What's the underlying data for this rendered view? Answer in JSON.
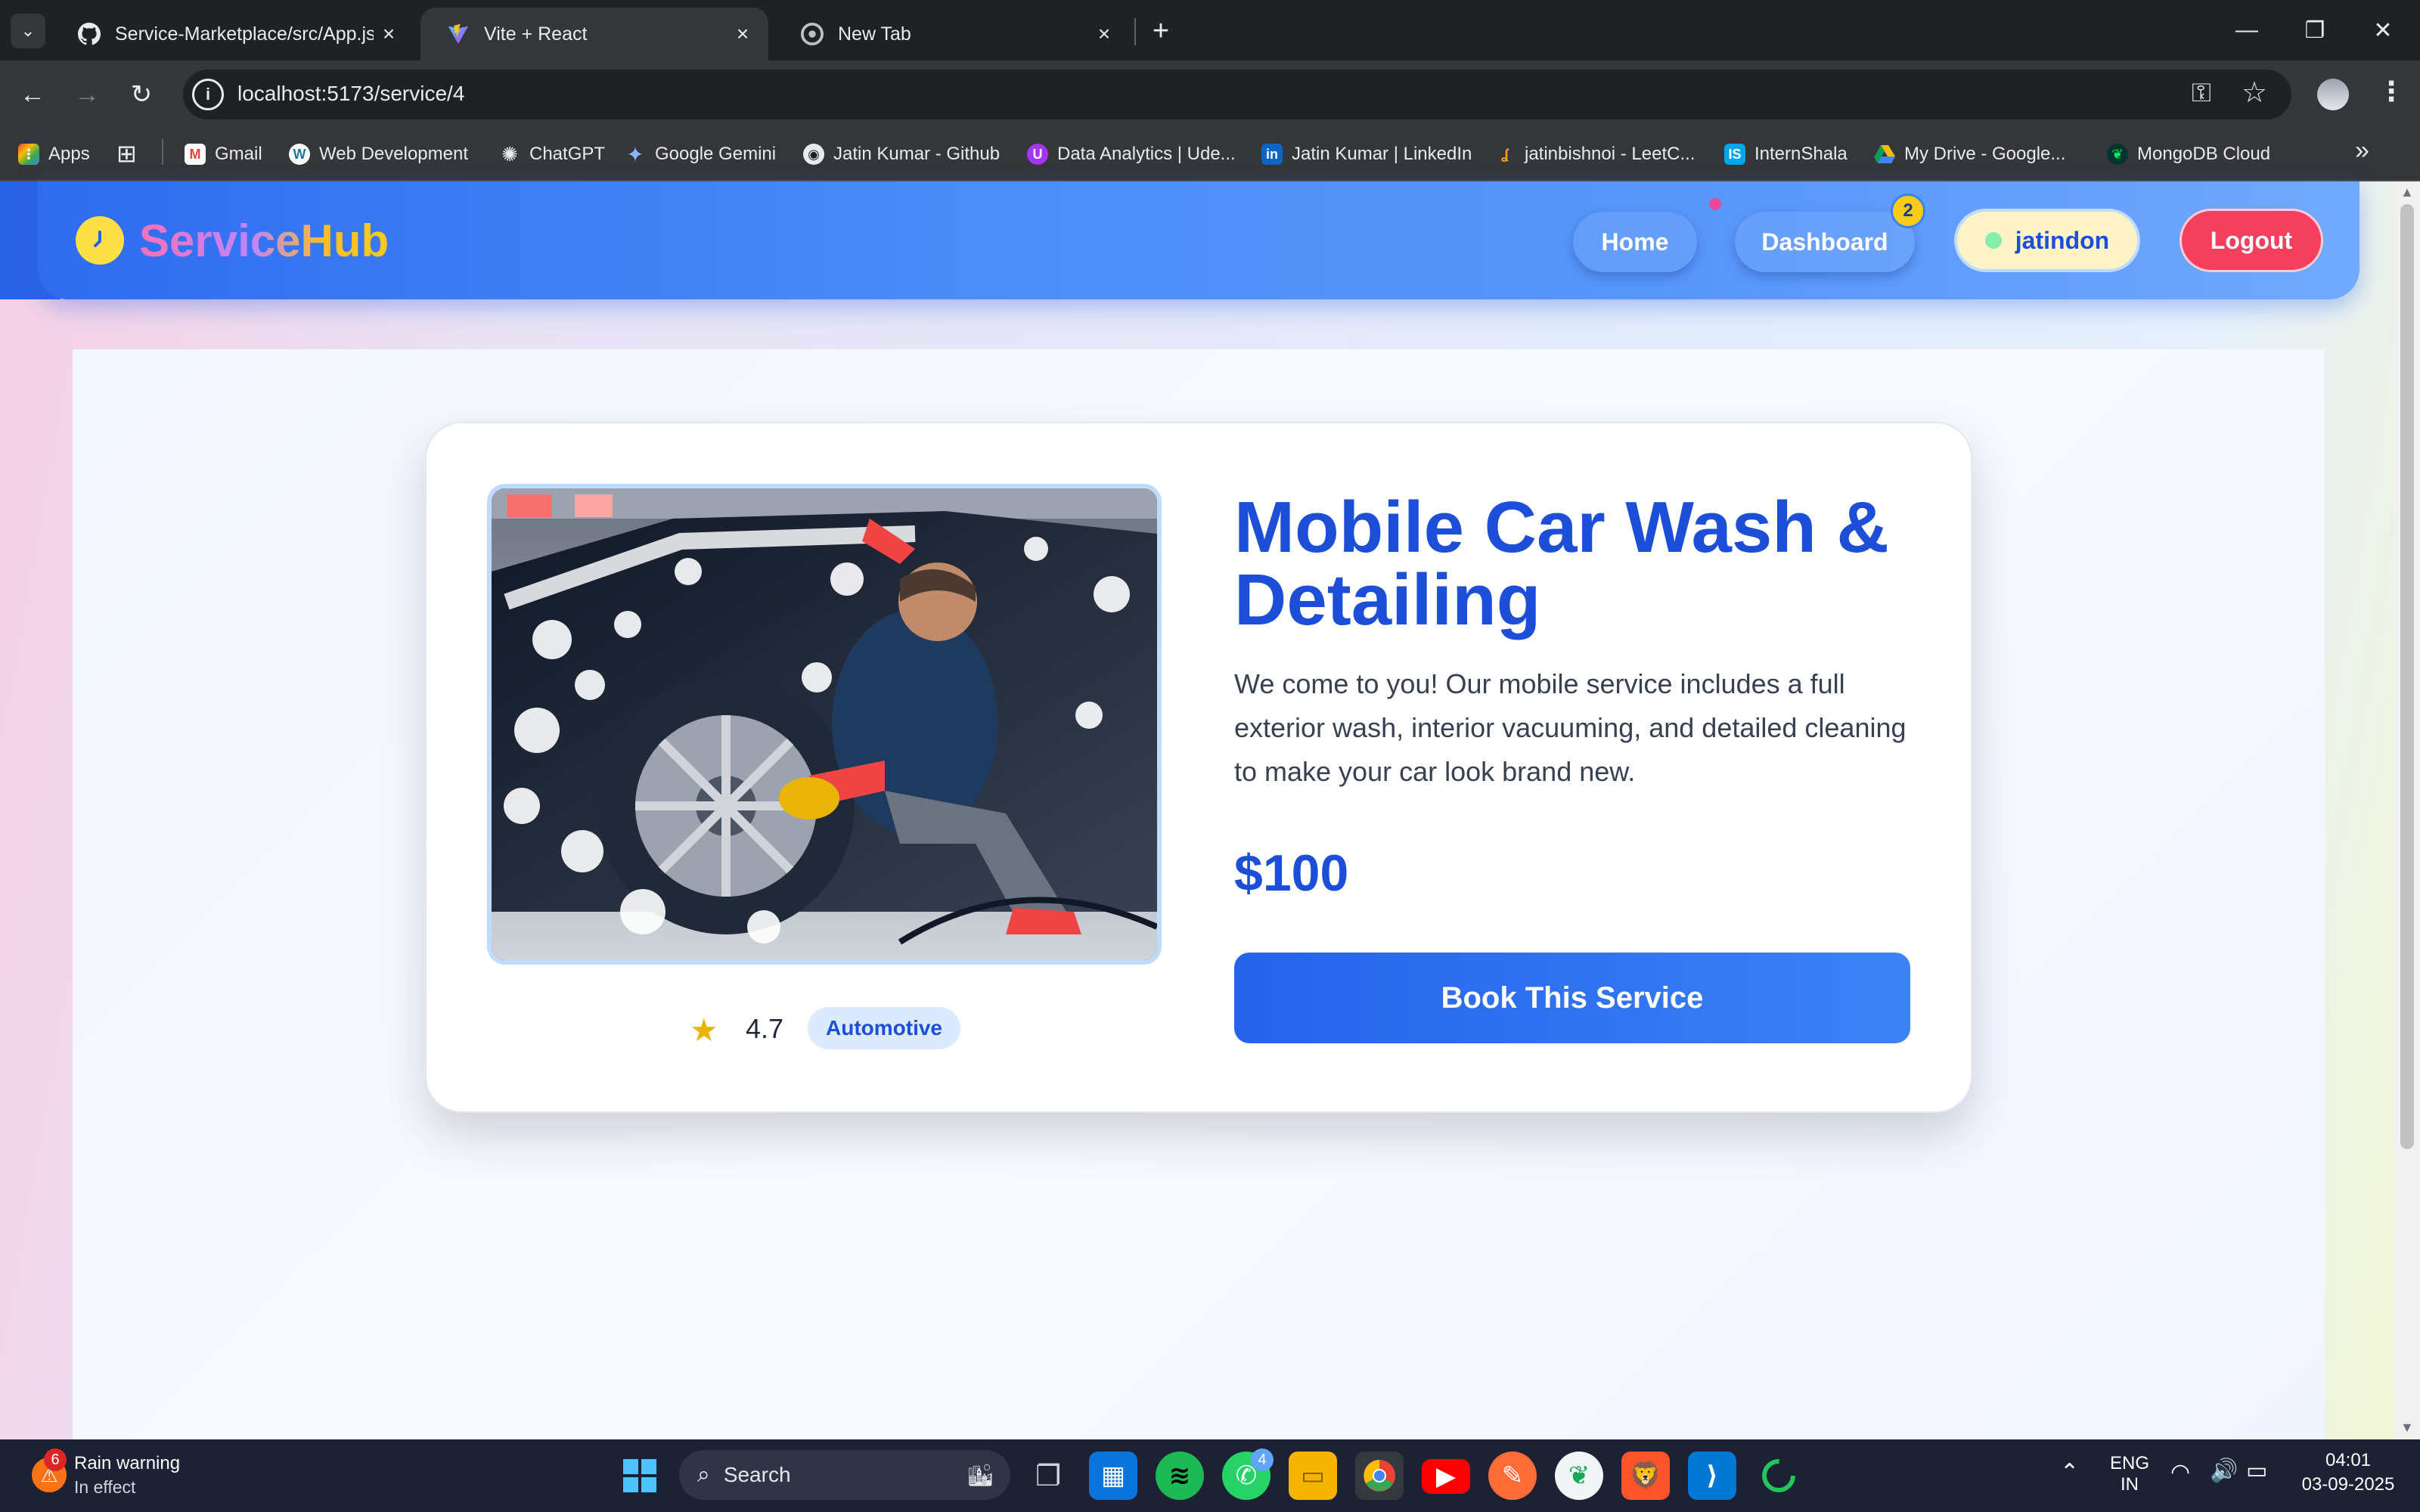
{
  "browser": {
    "tabs": [
      {
        "title": "Service-Marketplace/src/App.jsx",
        "favicon": "github-icon"
      },
      {
        "title": "Vite + React",
        "favicon": "vite-icon",
        "active": true
      },
      {
        "title": "New Tab",
        "favicon": "chrome-icon"
      }
    ],
    "url": "localhost:5173/service/4",
    "bookmarks": [
      {
        "label": "Apps",
        "icon": "apps-grid-icon"
      },
      {
        "label": "Gmail",
        "icon": "gmail-icon"
      },
      {
        "label": "Web Development",
        "icon": "wordpress-icon"
      },
      {
        "label": "ChatGPT",
        "icon": "chatgpt-icon"
      },
      {
        "label": "Google Gemini",
        "icon": "gemini-icon"
      },
      {
        "label": "Jatin Kumar - Github",
        "icon": "github-icon"
      },
      {
        "label": "Data Analytics | Ude...",
        "icon": "udemy-icon"
      },
      {
        "label": "Jatin Kumar | LinkedIn",
        "icon": "linkedin-icon"
      },
      {
        "label": "jatinbishnoi - LeetC...",
        "icon": "leetcode-icon"
      },
      {
        "label": "InternShala",
        "icon": "internshala-icon"
      },
      {
        "label": "My Drive - Google...",
        "icon": "drive-icon"
      },
      {
        "label": "MongoDB Cloud",
        "icon": "mongodb-icon"
      }
    ]
  },
  "app": {
    "brand": "ServiceHub",
    "nav": {
      "home": "Home",
      "dashboard": "Dashboard",
      "dashboard_badge": "2",
      "user": "jatindon",
      "logout": "Logout"
    },
    "colors": {
      "primary": "#1d4ed8",
      "logout": "#f43f5e",
      "badge": "#facc15"
    }
  },
  "service": {
    "title": "Mobile Car Wash & Detailing",
    "description": "We come to you! Our mobile service includes a full exterior wash, interior vacuuming, and detailed cleaning to make your car look brand new.",
    "price": "$100",
    "rating": "4.7",
    "category": "Automotive",
    "book_label": "Book This Service",
    "image_alt": "car-wash-photo"
  },
  "taskbar": {
    "weather_badge": "6",
    "weather_title": "Rain warning",
    "weather_sub": "In effect",
    "search_placeholder": "Search",
    "whatsapp_badge": "4",
    "lang": "ENG",
    "region": "IN",
    "time": "04:01",
    "date": "03-09-2025"
  }
}
